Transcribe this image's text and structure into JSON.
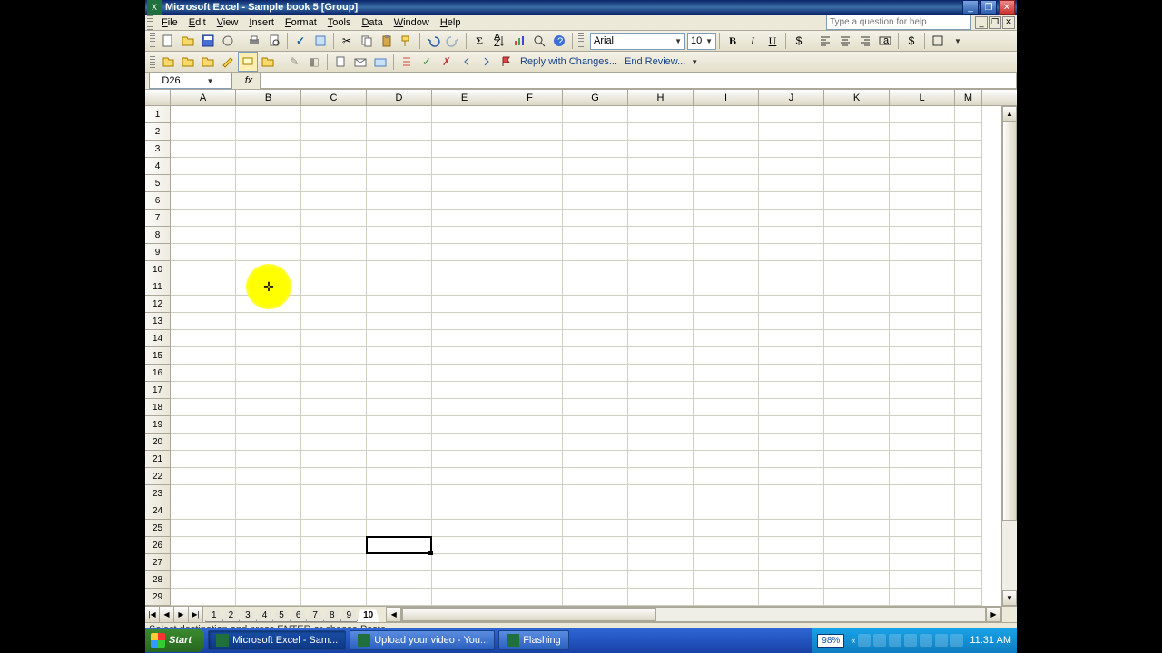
{
  "titlebar": {
    "app": "Microsoft Excel",
    "doc": "Sample book 5",
    "suffix": "[Group]"
  },
  "menus": [
    "File",
    "Edit",
    "View",
    "Insert",
    "Format",
    "Tools",
    "Data",
    "Window",
    "Help"
  ],
  "help_placeholder": "Type a question for help",
  "font": {
    "name": "Arial",
    "size": "10"
  },
  "review": {
    "reply": "Reply with Changes...",
    "end": "End Review..."
  },
  "namebox": "D26",
  "formula": "",
  "columns": [
    "A",
    "B",
    "C",
    "D",
    "E",
    "F",
    "G",
    "H",
    "I",
    "J",
    "K",
    "L",
    "M"
  ],
  "row_count": 29,
  "sheet_tabs": [
    "1",
    "2",
    "3",
    "4",
    "5",
    "6",
    "7",
    "8",
    "9",
    "10"
  ],
  "active_tab_index": 9,
  "selected": {
    "col_index": 3,
    "row_index": 25
  },
  "highlight": {
    "col_index": 1,
    "row_between": 10
  },
  "status": "Select destination and press ENTER or choose Paste",
  "taskbar": {
    "start": "Start",
    "items": [
      {
        "label": "Microsoft Excel - Sam...",
        "active": true
      },
      {
        "label": "Upload your video - You...",
        "active": false
      },
      {
        "label": "Flashing",
        "active": false
      }
    ],
    "zoom": "98%",
    "clock": "11:31 AM"
  }
}
